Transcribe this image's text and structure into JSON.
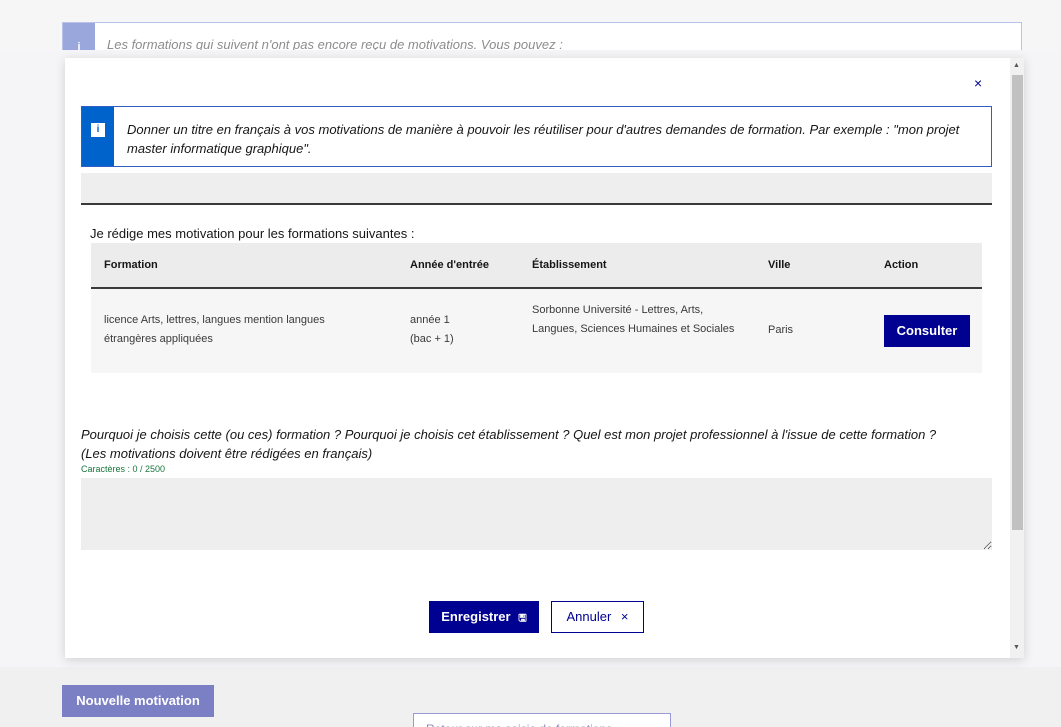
{
  "background": {
    "info_text": "Les formations qui suivent n'ont pas encore reçu de motivations. Vous pouvez :",
    "info_icon": "i",
    "new_motivation_label": "Nouvelle motivation",
    "return_label": "Retour sur ma saisie de formations"
  },
  "modal": {
    "close_label": "×",
    "callout_icon": "i",
    "callout_text": "Donner un titre en français à vos motivations de manière à pouvoir les réutiliser pour d'autres demandes de formation. Par exemple : \"mon projet master informatique graphique\".",
    "title_input_value": "",
    "intro": "Je rédige mes motivation pour les formations suivantes :",
    "table": {
      "headers": [
        "Formation",
        "Année d'entrée",
        "Établissement",
        "Ville",
        "Action"
      ],
      "rows": [
        {
          "formation": "licence Arts, lettres, langues mention langues étrangères appliquées",
          "annee_line1": "année 1",
          "annee_line2": "(bac + 1)",
          "etablissement": "Sorbonne Université - Lettres, Arts, Langues, Sciences Humaines et Sociales",
          "ville": "Paris",
          "action_label": "Consulter"
        }
      ]
    },
    "question_line1": "Pourquoi je choisis cette (ou ces) formation ? Pourquoi je choisis cet établissement ? Quel est mon projet professionnel à l'issue de cette formation ?",
    "question_line2": "(Les motivations doivent être rédigées en français)",
    "counter": "Caractères : 0 / 2500",
    "motivation_value": "",
    "save_label": "Enregistrer",
    "save_icon": "🖫",
    "cancel_label": "Annuler",
    "cancel_icon": "×"
  },
  "colors": {
    "primary": "#000091",
    "info_blue": "#0063cb",
    "counter_green": "#18753c"
  }
}
